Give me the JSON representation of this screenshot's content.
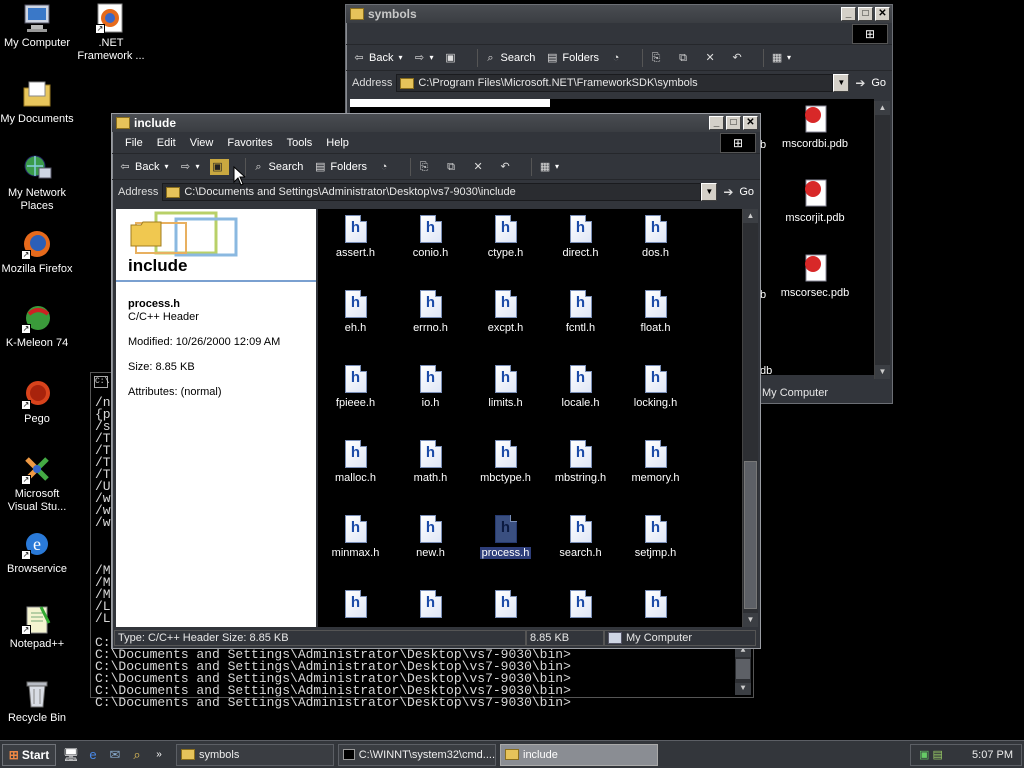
{
  "desktop": {
    "icons": [
      {
        "label": "My Computer",
        "icon": "computer-icon"
      },
      {
        "label": ".NET Framework ...",
        "icon": "firefox-icon"
      },
      {
        "label": "My Documents",
        "icon": "documents-folder-icon"
      },
      {
        "label": "My Network Places",
        "icon": "network-icon"
      },
      {
        "label": "Mozilla Firefox",
        "icon": "firefox-icon"
      },
      {
        "label": "K-Meleon 74",
        "icon": "kmeleon-icon"
      },
      {
        "label": "Pego",
        "icon": "pego-icon"
      },
      {
        "label": "Microsoft Visual Stu...",
        "icon": "visual-studio-icon"
      },
      {
        "label": "Browservice",
        "icon": "ie-icon"
      },
      {
        "label": "Notepad++",
        "icon": "notepad-icon"
      },
      {
        "label": "Recycle Bin",
        "icon": "recycle-bin-icon"
      }
    ]
  },
  "symbols_window": {
    "title": "symbols",
    "toolbar": {
      "back": "Back",
      "search": "Search",
      "folders": "Folders"
    },
    "address_label": "Address",
    "address": "C:\\Program Files\\Microsoft.NET\\FrameworkSDK\\symbols",
    "go": "Go",
    "files": [
      {
        "name": "mscordbi.pdb"
      },
      {
        "name": "mscorjit.pdb"
      },
      {
        "name": "mscorsec.pdb"
      }
    ],
    "partial_labels": [
      "b",
      "b",
      "db"
    ],
    "status_location": "My Computer"
  },
  "include_window": {
    "title": "include",
    "menu": [
      "File",
      "Edit",
      "View",
      "Favorites",
      "Tools",
      "Help"
    ],
    "toolbar": {
      "back": "Back",
      "search": "Search",
      "folders": "Folders"
    },
    "address_label": "Address",
    "address": "C:\\Documents and Settings\\Administrator\\Desktop\\vs7-9030\\include",
    "go": "Go",
    "left_panel": {
      "folder_title": "include",
      "selected_name": "process.h",
      "selected_type": "C/C++ Header",
      "modified": "Modified: 10/26/2000 12:09 AM",
      "size": "Size: 8.85 KB",
      "attributes": "Attributes: (normal)"
    },
    "files": [
      "assert.h",
      "conio.h",
      "ctype.h",
      "direct.h",
      "dos.h",
      "eh.h",
      "errno.h",
      "excpt.h",
      "fcntl.h",
      "float.h",
      "fpieee.h",
      "io.h",
      "limits.h",
      "locale.h",
      "locking.h",
      "malloc.h",
      "math.h",
      "mbctype.h",
      "mbstring.h",
      "memory.h",
      "minmax.h",
      "new.h",
      "process.h",
      "search.h",
      "setjmp.h",
      "",
      "",
      "",
      "",
      ""
    ],
    "selected_file": "process.h",
    "status": {
      "info": "Type: C/C++ Header Size: 8.85 KB",
      "size": "8.85 KB",
      "location": "My Computer"
    }
  },
  "console": {
    "left_fragments": [
      "/n",
      "{p",
      "/s",
      "/T",
      "/T",
      "/T",
      "/T",
      "/U",
      "/w",
      "/w",
      "/w",
      "",
      "",
      "",
      "/M",
      "/M",
      "/M",
      "/L",
      "/L"
    ],
    "lines": [
      "C:\\Documents and Settings\\Administrator\\Desktop\\vs7-9030\\bin>",
      "C:\\Documents and Settings\\Administrator\\Desktop\\vs7-9030\\bin>",
      "C:\\Documents and Settings\\Administrator\\Desktop\\vs7-9030\\bin>",
      "C:\\Documents and Settings\\Administrator\\Desktop\\vs7-9030\\bin>",
      "C:\\Documents and Settings\\Administrator\\Desktop\\vs7-9030\\bin>"
    ],
    "first_prefix": "C:"
  },
  "taskbar": {
    "start": "Start",
    "tasks": [
      {
        "label": "symbols",
        "active": false
      },
      {
        "label": "C:\\WINNT\\system32\\cmd....",
        "active": false
      },
      {
        "label": "include",
        "active": true
      }
    ],
    "clock": "5:07 PM"
  }
}
